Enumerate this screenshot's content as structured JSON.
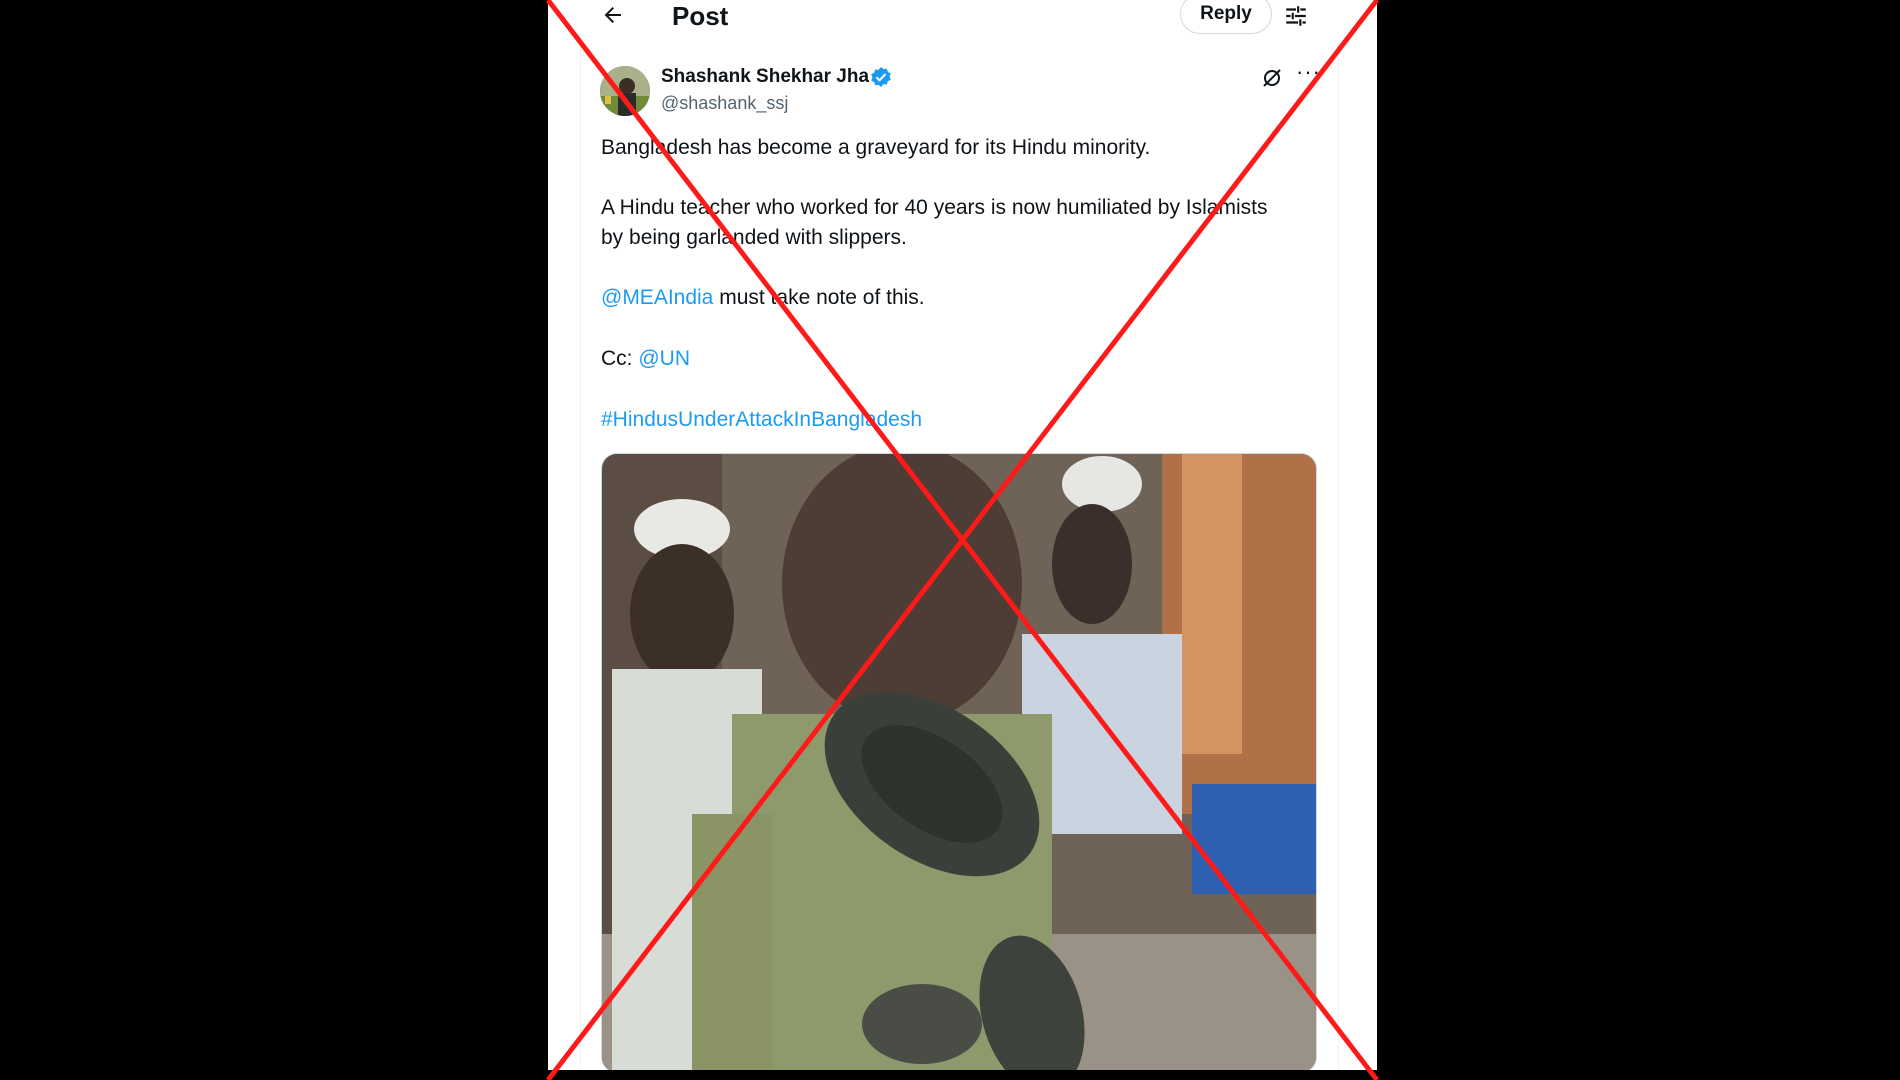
{
  "header": {
    "title": "Post",
    "reply_label": "Reply"
  },
  "post": {
    "author_name": "Shashank Shekhar Jha",
    "author_handle": "@shashank_ssj",
    "line1": "Bangladesh has become a graveyard for its Hindu minority.",
    "line2a": "A Hindu teacher who worked for 40 years is now humiliated by Islamists",
    "line2b": "by being garlanded with slippers.",
    "mention1": "@MEAIndia",
    "line3_rest": " must take note of this.",
    "cc_prefix": "Cc: ",
    "mention2": "@UN",
    "hashtag": "#HindusUnderAttackInBangladesh"
  },
  "icons": {
    "back": "arrow-left-icon",
    "tune": "sliders-icon",
    "verified": "verified-badge-icon",
    "grok": "grok-icon",
    "more": "more-horizontal-icon"
  },
  "colors": {
    "link": "#1d9bf0",
    "text": "#0f1419",
    "secondary": "#536471",
    "cross": "#ff1a1a"
  }
}
